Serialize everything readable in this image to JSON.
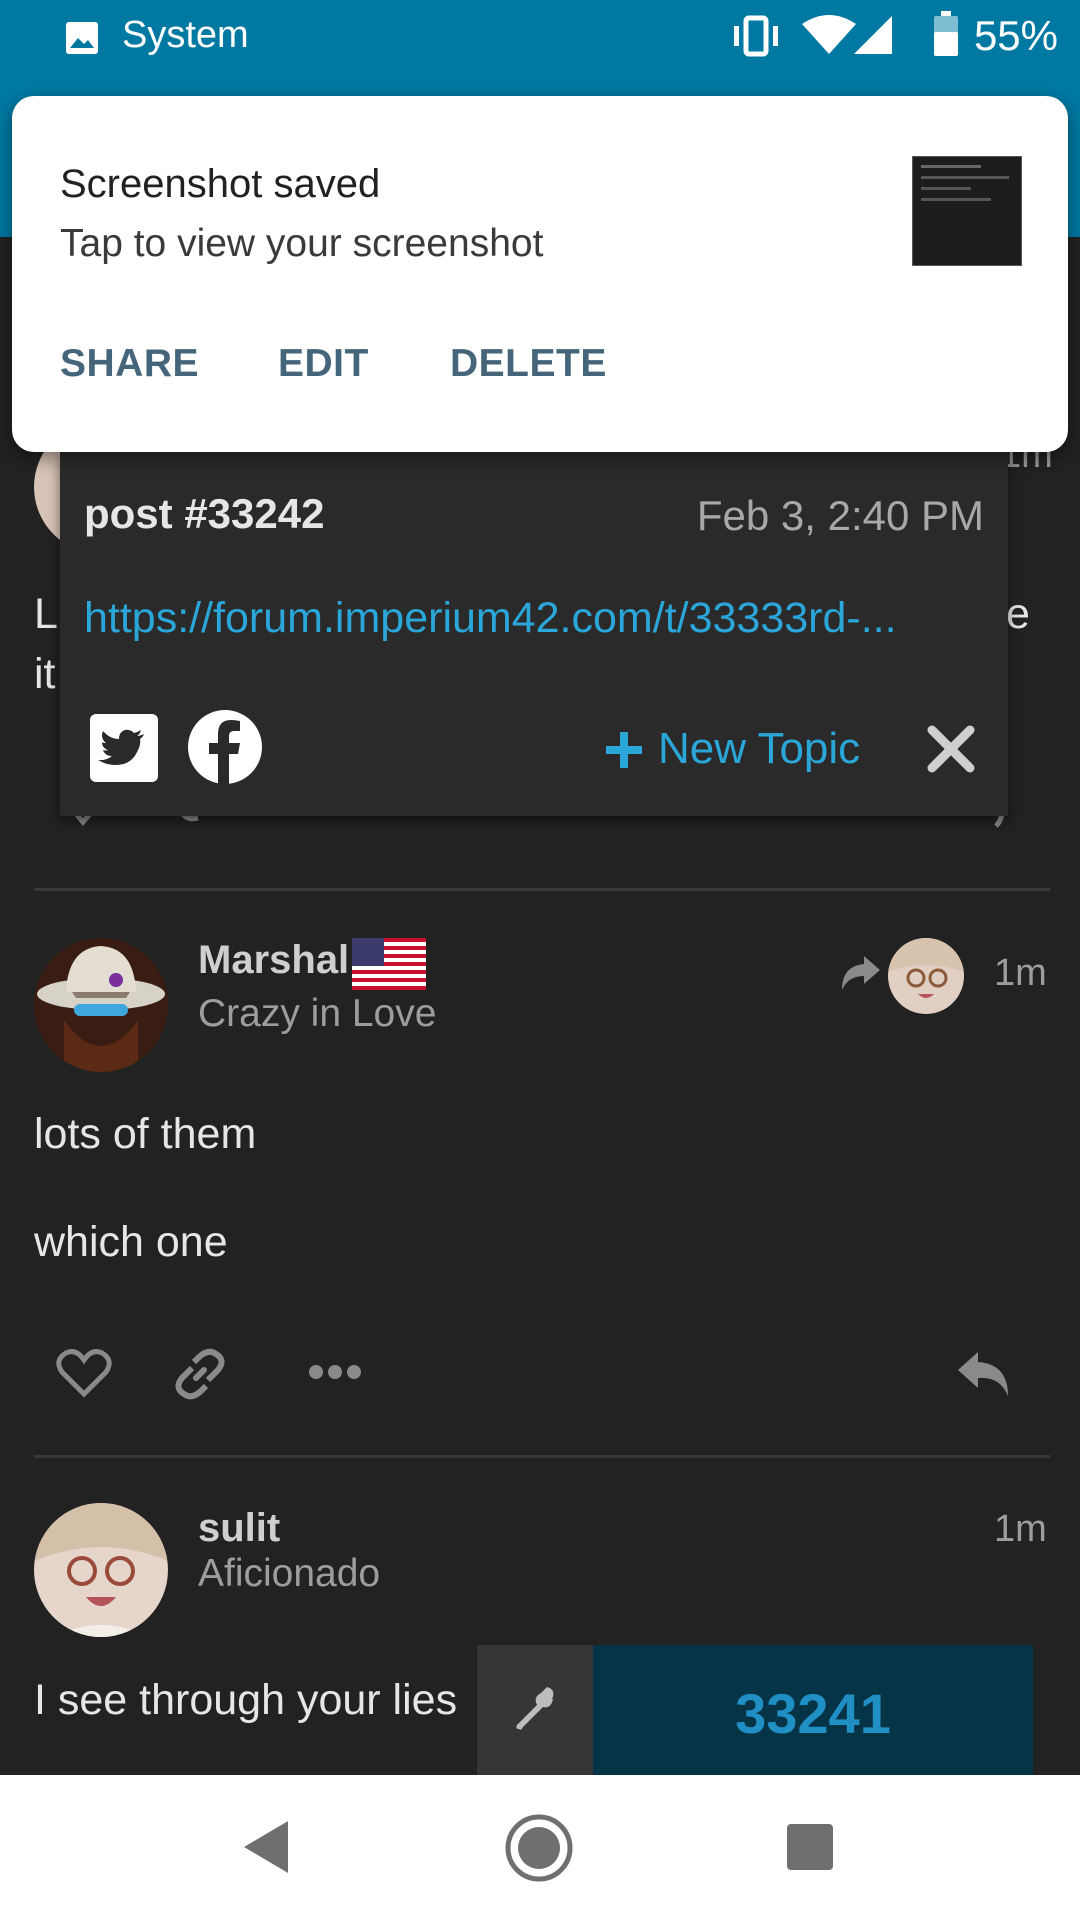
{
  "status_bar": {
    "app_label": "System",
    "battery": "55%"
  },
  "notification": {
    "title": "Screenshot saved",
    "text": "Tap to view your screenshot",
    "actions": {
      "share": "SHARE",
      "edit": "EDIT",
      "delete": "DELETE"
    }
  },
  "share_popup": {
    "post_label": "post #33242",
    "date": "Feb 3, 2:40 PM",
    "link": "https://forum.imperium42.com/t/33333rd-...",
    "new_topic": "New Topic"
  },
  "hidden_post": {
    "text_fragments": [
      "L",
      "e",
      "it"
    ],
    "time": "1m"
  },
  "posts": [
    {
      "username": "Marshal",
      "user_title": "Crazy in Love",
      "time": "1m",
      "body": [
        "lots of them",
        "which one"
      ]
    },
    {
      "username": "sulit",
      "user_title": "Aficionado",
      "time": "1m",
      "body": [
        "I see through your lies"
      ]
    }
  ],
  "progress_badge": "33241",
  "colors": {
    "status_bar": "#0079a2",
    "background": "#222222",
    "link": "#2ba6d8",
    "notification_action": "#45667a",
    "badge_bg": "#063447"
  }
}
